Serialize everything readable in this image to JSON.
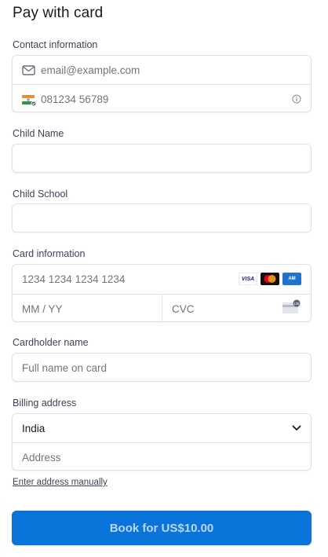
{
  "page": {
    "title": "Pay with card"
  },
  "contact": {
    "label": "Contact information",
    "email_placeholder": "email@example.com",
    "phone_placeholder": "081234 56789",
    "email_icon": "envelope-icon",
    "country_flag": "india-flag-icon",
    "info_icon": "info-icon"
  },
  "child_name": {
    "label": "Child Name",
    "value": ""
  },
  "child_school": {
    "label": "Child School",
    "value": ""
  },
  "card": {
    "label": "Card information",
    "number_placeholder": "1234 1234 1234 1234",
    "expiry_placeholder": "MM / YY",
    "cvc_placeholder": "CVC",
    "brands": [
      "VISA",
      "Mastercard",
      "Amex"
    ],
    "visa_text": "VISA",
    "amex_text": "AM"
  },
  "cardholder": {
    "label": "Cardholder name",
    "placeholder": "Full name on card"
  },
  "billing": {
    "label": "Billing address",
    "country": "India",
    "address_placeholder": "Address",
    "manual_link": "Enter address manually"
  },
  "submit": {
    "label": "Book for US$10.00",
    "color": "#0a74da"
  }
}
